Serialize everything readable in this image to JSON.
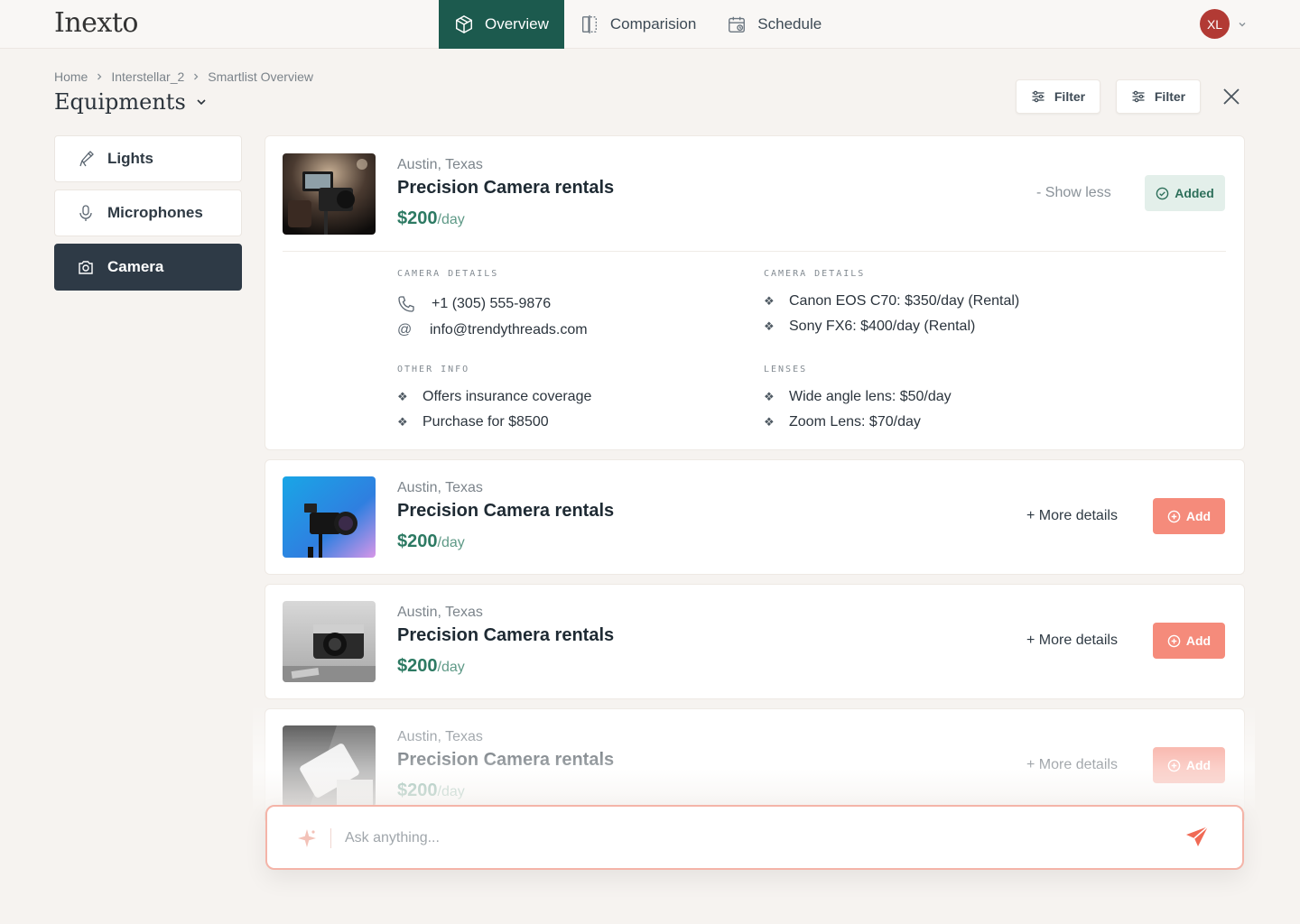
{
  "app": {
    "logo": "Inexto"
  },
  "nav": {
    "tabs": [
      {
        "label": "Overview",
        "icon": "box-icon",
        "active": true
      },
      {
        "label": "Comparision",
        "icon": "compare-icon",
        "active": false
      },
      {
        "label": "Schedule",
        "icon": "calendar-icon",
        "active": false
      }
    ],
    "user_initials": "XL"
  },
  "breadcrumb": [
    "Home",
    "Interstellar_2",
    "Smartlist Overview"
  ],
  "page": {
    "title": "Equipments"
  },
  "toolbar": {
    "filter1": "Filter",
    "filter2": "Filter"
  },
  "sidebar": {
    "items": [
      {
        "label": "Lights",
        "icon": "light-icon",
        "active": false
      },
      {
        "label": "Microphones",
        "icon": "microphone-icon",
        "active": false
      },
      {
        "label": "Camera",
        "icon": "camera-icon",
        "active": true
      }
    ]
  },
  "listings": [
    {
      "location": "Austin, Texas",
      "title": "Precision Camera rentals",
      "price": "$200",
      "unit": "/day",
      "toggle_label": "- Show less",
      "status_label": "Added",
      "expanded": true,
      "details": {
        "contact_heading": "CAMERA DETAILS",
        "phone": "+1 (305) 555-9876",
        "email": "info@trendythreads.com",
        "other_heading": "OTHER INFO",
        "other": [
          "Offers insurance coverage",
          "Purchase for $8500"
        ],
        "camera_heading": "CAMERA DETAILS",
        "cameras": [
          "Canon EOS C70: $350/day (Rental)",
          "Sony FX6: $400/day (Rental)"
        ],
        "lenses_heading": "LENSES",
        "lenses": [
          "Wide angle lens: $50/day",
          "Zoom Lens: $70/day"
        ]
      }
    },
    {
      "location": "Austin, Texas",
      "title": "Precision Camera rentals",
      "price": "$200",
      "unit": "/day",
      "toggle_label": "+ More details",
      "status_label": "Add"
    },
    {
      "location": "Austin, Texas",
      "title": "Precision Camera rentals",
      "price": "$200",
      "unit": "/day",
      "toggle_label": "+ More details",
      "status_label": "Add"
    },
    {
      "location": "Austin, Texas",
      "title": "Precision Camera rentals",
      "price": "$200",
      "unit": "/day",
      "toggle_label": "+ More details",
      "status_label": "Add"
    }
  ],
  "ask": {
    "placeholder": "Ask anything..."
  },
  "colors": {
    "primary": "#1c5a4e",
    "accent": "#f58b7b",
    "price": "#2d7a63",
    "sidebar_active": "#2e3a46",
    "avatar": "#b23a34"
  }
}
